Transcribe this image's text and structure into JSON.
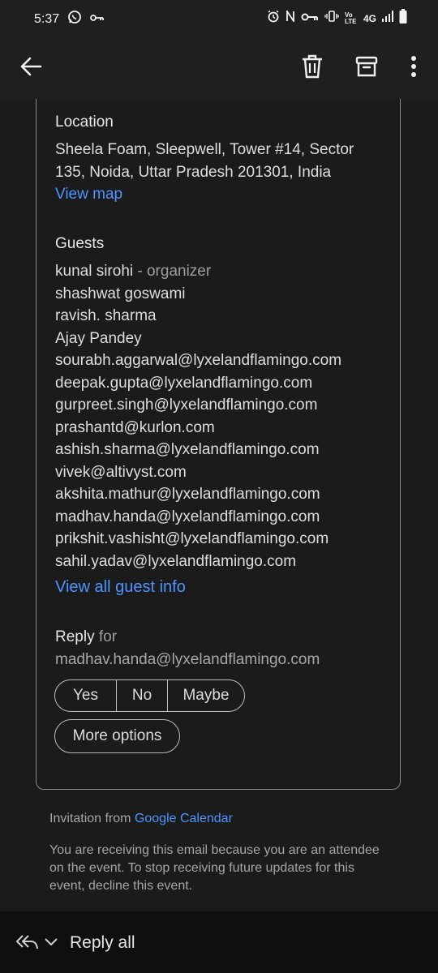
{
  "status_bar": {
    "time": "5:37",
    "network": "4G",
    "volte": "Vo LTE",
    "icons": [
      "whatsapp-icon",
      "key-icon",
      "alarm-icon",
      "nfc-icon",
      "vpn-key-icon",
      "vibrate-icon",
      "signal-icon",
      "battery-icon"
    ]
  },
  "toolbar": {
    "icons": [
      "back-arrow-icon",
      "trash-icon",
      "archive-icon",
      "more-vertical-icon"
    ]
  },
  "event": {
    "location_heading": "Location",
    "location_lines": [
      "Sheela Foam, Sleepwell, Tower #14, Sector",
      "135, Noida, Uttar Pradesh 201301, India"
    ],
    "view_map": "View map",
    "guests_heading": "Guests",
    "organizer_name": "kunal sirohi",
    "organizer_tag": " - organizer",
    "guests": [
      "shashwat goswami",
      "ravish. sharma",
      "Ajay Pandey",
      "sourabh.aggarwal@lyxelandflamingo.com",
      "deepak.gupta@lyxelandflamingo.com",
      "gurpreet.singh@lyxelandflamingo.com",
      "prashantd@kurlon.com",
      "ashish.sharma@lyxelandflamingo.com",
      "vivek@altivyst.com",
      "akshita.mathur@lyxelandflamingo.com",
      "madhav.handa@lyxelandflamingo.com",
      "prikshit.vashisht@lyxelandflamingo.com",
      "sahil.yadav@lyxelandflamingo.com"
    ],
    "view_all_guests": "View all guest info",
    "reply_label": "Reply",
    "reply_for": " for",
    "reply_email": "madhav.handa@lyxelandflamingo.com",
    "rsvp": {
      "yes": "Yes",
      "no": "No",
      "maybe": "Maybe"
    },
    "more_options": "More options"
  },
  "footer": {
    "invitation_prefix": "Invitation from ",
    "invitation_link": "Google Calendar",
    "notice_lines": [
      "You are receiving this email because you are an attendee",
      "on the event. To stop receiving future updates for this",
      "event, decline this event."
    ]
  },
  "bottom_bar": {
    "reply_all": "Reply all"
  },
  "colors": {
    "link": "#4f93ff",
    "background": "#1b1b1b",
    "toolbar": "#1f1f1f",
    "bottom_bar": "#0f0f0f"
  }
}
